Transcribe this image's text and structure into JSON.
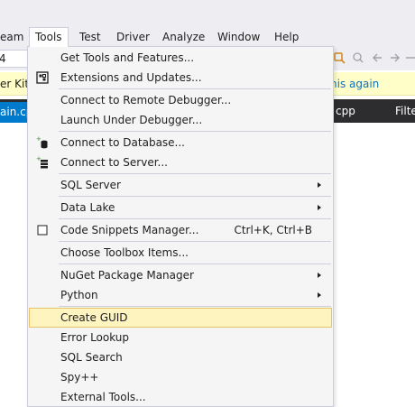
{
  "menubar": {
    "items": [
      "eam",
      "Tools",
      "Test",
      "Driver",
      "Analyze",
      "Window",
      "Help"
    ]
  },
  "toolbar": {
    "combo_value": "4"
  },
  "infobar": {
    "left_text": "er Kit' ",
    "link_text": "his again"
  },
  "tabs": {
    "active_tab": "ain.cpp",
    "right_tab": "cpp",
    "filter_label": "Filte"
  },
  "tools_menu": {
    "items": [
      {
        "label": "Get Tools and Features..."
      },
      {
        "label": "Extensions and Updates...",
        "icon": "extensions-icon"
      },
      {
        "label": "Connect to Remote Debugger..."
      },
      {
        "label": "Launch Under Debugger..."
      },
      {
        "label": "Connect to Database...",
        "icon": "database-connect-icon"
      },
      {
        "label": "Connect to Server...",
        "icon": "server-connect-icon"
      },
      {
        "label": "SQL Server",
        "submenu": true
      },
      {
        "label": "Data Lake",
        "submenu": true
      },
      {
        "label": "Code Snippets Manager...",
        "shortcut": "Ctrl+K, Ctrl+B",
        "icon": "checkbox-icon"
      },
      {
        "label": "Choose Toolbox Items..."
      },
      {
        "label": "NuGet Package Manager",
        "submenu": true
      },
      {
        "label": "Python",
        "submenu": true
      },
      {
        "label": "Create GUID",
        "highlighted": true
      },
      {
        "label": "Error Lookup"
      },
      {
        "label": "SQL Search"
      },
      {
        "label": "Spy++"
      },
      {
        "label": "External Tools..."
      }
    ]
  },
  "colors": {
    "menu_bg": "#f5f5f5",
    "highlight": "#fdf4bf",
    "infobar": "#fffec8",
    "tab_active": "#007acc",
    "tabstrip": "#2d2d30"
  }
}
